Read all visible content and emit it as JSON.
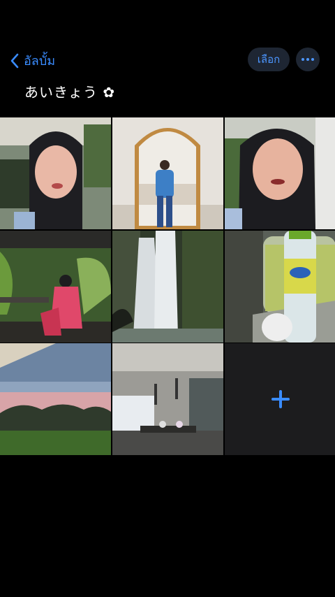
{
  "nav": {
    "back_label": "อัลบั้ม",
    "select_label": "เลือก"
  },
  "album": {
    "title": "あいきょう ✿"
  },
  "photos": [
    {
      "subject": "selfie in hijab"
    },
    {
      "subject": "mirror photo"
    },
    {
      "subject": "selfie in hijab"
    },
    {
      "subject": "sitting in garden"
    },
    {
      "subject": "waterfall"
    },
    {
      "subject": "water bottle on train"
    },
    {
      "subject": "tea field landscape"
    },
    {
      "subject": "cafe interior"
    }
  ],
  "colors": {
    "accent": "#3a8cff",
    "button_bg": "#1e2633",
    "add_tile_bg": "#1c1c1e"
  }
}
